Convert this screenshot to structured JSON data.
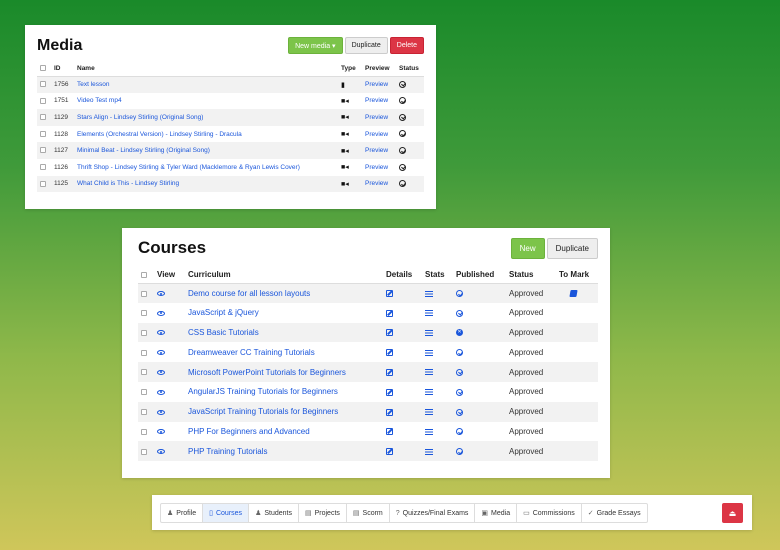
{
  "media": {
    "title": "Media",
    "buttons": {
      "new": "New media ▾",
      "duplicate": "Duplicate",
      "delete": "Delete"
    },
    "columns": [
      "ID",
      "Name",
      "Type",
      "Preview",
      "Status"
    ],
    "rows": [
      {
        "id": "1756",
        "name": "Text lesson",
        "type": "text",
        "preview": "Preview"
      },
      {
        "id": "1751",
        "name": "Video Test mp4",
        "type": "video",
        "preview": "Preview"
      },
      {
        "id": "1129",
        "name": "Stars Align - Lindsey Stirling (Original Song)",
        "type": "video",
        "preview": "Preview"
      },
      {
        "id": "1128",
        "name": "Elements (Orchestral Version) - Lindsey Stirling - Dracula",
        "type": "video",
        "preview": "Preview"
      },
      {
        "id": "1127",
        "name": "Minimal Beat - Lindsey Stirling (Original Song)",
        "type": "video",
        "preview": "Preview"
      },
      {
        "id": "1126",
        "name": "Thrift Shop - Lindsey Stirling & Tyler Ward (Macklemore & Ryan Lewis Cover)",
        "type": "video",
        "preview": "Preview"
      },
      {
        "id": "1125",
        "name": "What Child is This - Lindsey Stirling",
        "type": "video",
        "preview": "Preview"
      }
    ]
  },
  "courses": {
    "title": "Courses",
    "buttons": {
      "new": "New",
      "duplicate": "Duplicate"
    },
    "columns": [
      "View",
      "Curriculum",
      "Details",
      "Stats",
      "Published",
      "Status",
      "To Mark"
    ],
    "rows": [
      {
        "name": "Demo course for all lesson layouts",
        "status": "Approved",
        "published": "check",
        "to_mark": true
      },
      {
        "name": "JavaScript & jQuery",
        "status": "Approved",
        "published": "check",
        "to_mark": false
      },
      {
        "name": "CSS Basic Tutorials",
        "status": "Approved",
        "published": "x",
        "to_mark": false
      },
      {
        "name": "Dreamweaver CC Training Tutorials",
        "status": "Approved",
        "published": "check",
        "to_mark": false
      },
      {
        "name": "Microsoft PowerPoint Tutorials for Beginners",
        "status": "Approved",
        "published": "check",
        "to_mark": false
      },
      {
        "name": "AngularJS Training Tutorials for Beginners",
        "status": "Approved",
        "published": "check",
        "to_mark": false
      },
      {
        "name": "JavaScript Training Tutorials for Beginners",
        "status": "Approved",
        "published": "check",
        "to_mark": false
      },
      {
        "name": "PHP For Beginners and Advanced",
        "status": "Approved",
        "published": "check",
        "to_mark": false
      },
      {
        "name": "PHP Training Tutorials",
        "status": "Approved",
        "published": "check",
        "to_mark": false
      }
    ]
  },
  "nav": {
    "tabs": [
      {
        "label": "Profile",
        "icon": "user-icon",
        "active": false
      },
      {
        "label": "Courses",
        "icon": "document-icon",
        "active": true
      },
      {
        "label": "Students",
        "icon": "user-icon",
        "active": false
      },
      {
        "label": "Projects",
        "icon": "file-icon",
        "active": false
      },
      {
        "label": "Scorm",
        "icon": "file-icon",
        "active": false
      },
      {
        "label": "Quizzes/Final Exams",
        "icon": "question-icon",
        "active": false
      },
      {
        "label": "Media",
        "icon": "image-icon",
        "active": false
      },
      {
        "label": "Commissions",
        "icon": "money-icon",
        "active": false
      },
      {
        "label": "Grade Essays",
        "icon": "check-icon",
        "active": false
      }
    ],
    "logout_icon": "logout-icon"
  },
  "colors": {
    "accent": "#1a56db",
    "green": "#7cc44a",
    "red": "#dc3545"
  }
}
